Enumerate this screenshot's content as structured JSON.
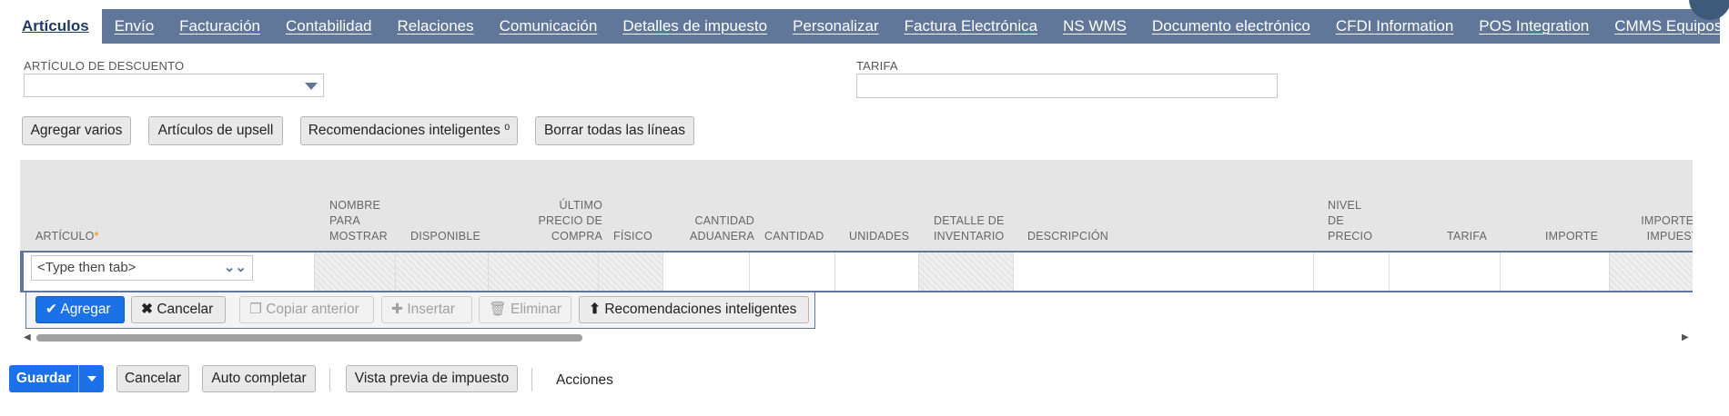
{
  "tabs": [
    {
      "label": "Artículos",
      "active": true
    },
    {
      "label": "Envío"
    },
    {
      "label": "Facturación"
    },
    {
      "label": "Contabilidad"
    },
    {
      "label": "Relaciones"
    },
    {
      "label": "Comunicación"
    },
    {
      "label": "Detalles de impuesto"
    },
    {
      "label": "Personalizar"
    },
    {
      "label": "Factura Electrónica"
    },
    {
      "label": "NS WMS"
    },
    {
      "label": "Documento electrónico"
    },
    {
      "label": "CFDI Information"
    },
    {
      "label": "POS Integration"
    },
    {
      "label": "CMMS Equipos Retirados"
    }
  ],
  "more_icon": "ellipsis-icon",
  "fields": {
    "discount_item_label": "ARTÍCULO DE DESCUENTO",
    "discount_item_value": "",
    "rate_label": "TARIFA",
    "rate_value": ""
  },
  "buttons": {
    "add_multiple": "Agregar varios",
    "upsell": "Artículos de upsell",
    "smart_recs": "Recomendaciones inteligentes ⁰",
    "clear_lines": "Borrar todas las líneas"
  },
  "grid": {
    "columns": {
      "item": "ARTÍCULO",
      "display_name": [
        "NOMBRE",
        "PARA",
        "MOSTRAR"
      ],
      "available": "DISPONIBLE",
      "last_price": [
        "ÚLTIMO",
        "PRECIO DE",
        "COMPRA"
      ],
      "physical": "FÍSICO",
      "customs_qty": [
        "CANTIDAD",
        "ADUANERA"
      ],
      "quantity": "CANTIDAD",
      "units": "UNIDADES",
      "inventory_detail": [
        "DETALLE DE",
        "INVENTARIO"
      ],
      "description": "DESCRIPCIÓN",
      "price_level": [
        "NIVEL",
        "DE",
        "PRECIO"
      ],
      "rate": "TARIFA",
      "amount": "IMPORTE",
      "tax_amount": [
        "IMPORTE DE",
        "IMPUESTO"
      ]
    },
    "item_placeholder": "<Type then tab>",
    "required_mark": "*"
  },
  "row_actions": {
    "add": "Agregar",
    "cancel": "Cancelar",
    "copy_previous": "Copiar anterior",
    "insert": "Insertar",
    "delete": "Eliminar",
    "smart_recs": "Recomendaciones inteligentes"
  },
  "footer": {
    "save": "Guardar",
    "cancel": "Cancelar",
    "autocomplete": "Auto completar",
    "tax_preview": "Vista previa de impuesto",
    "actions": "Acciones"
  },
  "colors": {
    "tab_bar": "#607799",
    "primary": "#1b72e8",
    "required": "#e88a00"
  }
}
